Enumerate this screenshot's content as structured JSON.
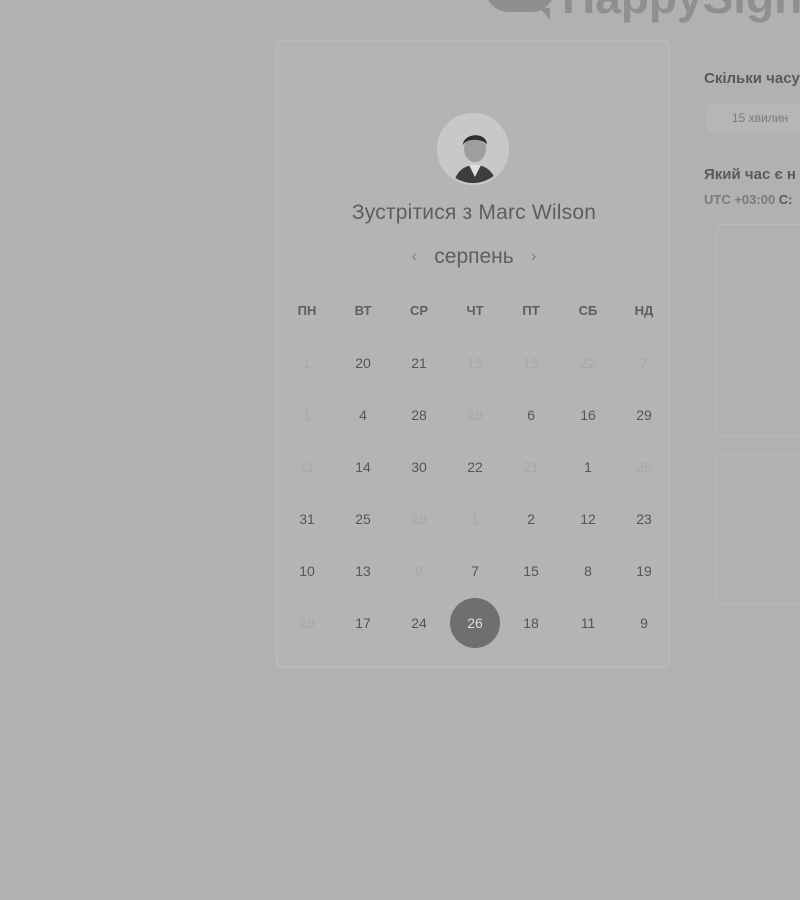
{
  "logo": {
    "text": "HappySign"
  },
  "card": {
    "title": "Зустрітися з Marc Wilson",
    "month": "серпень",
    "weekdays": [
      "ПН",
      "ВТ",
      "СР",
      "ЧТ",
      "ПТ",
      "СБ",
      "НД"
    ],
    "weeks": [
      [
        {
          "d": "1",
          "m": true
        },
        {
          "d": "20",
          "m": false
        },
        {
          "d": "21",
          "m": false
        },
        {
          "d": "15",
          "m": true
        },
        {
          "d": "15",
          "m": true
        },
        {
          "d": "22",
          "m": true
        },
        {
          "d": "7",
          "m": true
        }
      ],
      [
        {
          "d": "1",
          "m": true
        },
        {
          "d": "4",
          "m": false
        },
        {
          "d": "28",
          "m": false
        },
        {
          "d": "29",
          "m": true
        },
        {
          "d": "6",
          "m": false
        },
        {
          "d": "16",
          "m": false
        },
        {
          "d": "29",
          "m": false
        }
      ],
      [
        {
          "d": "11",
          "m": true
        },
        {
          "d": "14",
          "m": false
        },
        {
          "d": "30",
          "m": false
        },
        {
          "d": "22",
          "m": false
        },
        {
          "d": "21",
          "m": true
        },
        {
          "d": "1",
          "m": false
        },
        {
          "d": "26",
          "m": true
        }
      ],
      [
        {
          "d": "31",
          "m": false
        },
        {
          "d": "25",
          "m": false
        },
        {
          "d": "29",
          "m": true
        },
        {
          "d": "1",
          "m": true
        },
        {
          "d": "2",
          "m": false
        },
        {
          "d": "12",
          "m": false
        },
        {
          "d": "23",
          "m": false
        }
      ],
      [
        {
          "d": "10",
          "m": false
        },
        {
          "d": "13",
          "m": false
        },
        {
          "d": "9",
          "m": true
        },
        {
          "d": "7",
          "m": false
        },
        {
          "d": "15",
          "m": false
        },
        {
          "d": "8",
          "m": false
        },
        {
          "d": "19",
          "m": false
        }
      ],
      [
        {
          "d": "29",
          "m": true
        },
        {
          "d": "17",
          "m": false
        },
        {
          "d": "24",
          "m": false
        },
        {
          "d": "26",
          "m": false,
          "selected": true
        },
        {
          "d": "18",
          "m": false
        },
        {
          "d": "11",
          "m": false
        },
        {
          "d": "9",
          "m": false
        }
      ]
    ]
  },
  "right": {
    "duration_question": "Скільки часу",
    "duration_chip": "15 хвилин",
    "time_question": "Який час є н",
    "timezone_prefix": "UTC +03:00",
    "timezone_suffix": "С:"
  }
}
